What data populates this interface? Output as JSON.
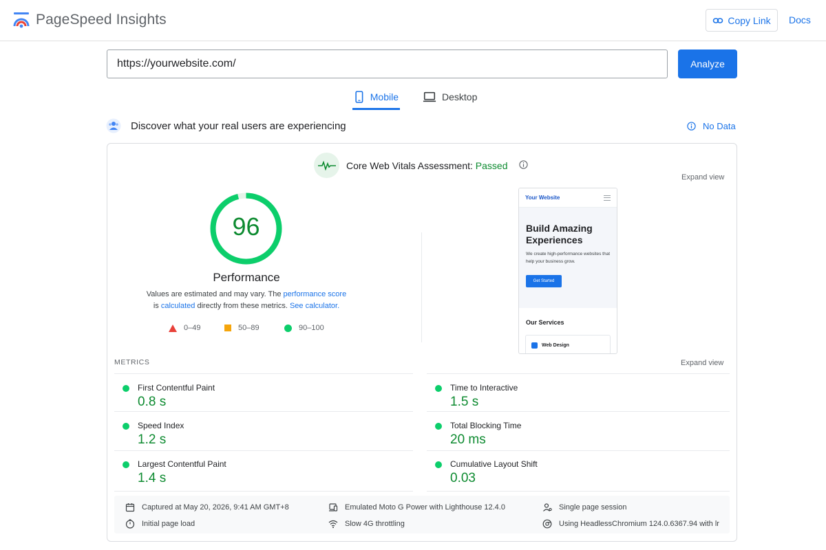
{
  "header": {
    "app_title": "PageSpeed Insights",
    "copy_link_label": "Copy Link",
    "docs_label": "Docs"
  },
  "url_bar": {
    "value": "https://yourwebsite.com/",
    "analyze_label": "Analyze"
  },
  "tabs": [
    {
      "label": "Mobile",
      "active": true
    },
    {
      "label": "Desktop",
      "active": false
    }
  ],
  "field_data": {
    "heading": "Discover what your real users are experiencing",
    "no_data_label": "No Data"
  },
  "assessment": {
    "label": "Core Web Vitals Assessment:",
    "status": "Passed",
    "expand_label": "Expand view"
  },
  "performance": {
    "score": "96",
    "score_fraction": 0.96,
    "title": "Performance",
    "desc_part1": "Values are estimated and may vary. The",
    "link_performance_score": "performance score",
    "desc_part2": "is",
    "link_calculated": "calculated",
    "desc_part3": "directly from these metrics.",
    "link_calculator": "See calculator."
  },
  "legend": [
    {
      "range": "0–49",
      "shape": "triangle",
      "color": "#e8413a"
    },
    {
      "range": "50–89",
      "shape": "square",
      "color": "#f5a50c"
    },
    {
      "range": "90–100",
      "shape": "circle",
      "color": "#0cce6b"
    }
  ],
  "preview": {
    "brand": "Your Website",
    "headline": "Build Amazing Experiences",
    "subtext": "We create high-performance websites that help your business grow.",
    "cta": "Get Started",
    "section_title": "Our Services",
    "service_item": "Web Design"
  },
  "metrics": {
    "title": "METRICS",
    "expand_label": "Expand view",
    "items": [
      {
        "label": "First Contentful Paint",
        "value": "0.8 s"
      },
      {
        "label": "Time to Interactive",
        "value": "1.5 s"
      },
      {
        "label": "Speed Index",
        "value": "1.2 s"
      },
      {
        "label": "Total Blocking Time",
        "value": "20 ms"
      },
      {
        "label": "Largest Contentful Paint",
        "value": "1.4 s"
      },
      {
        "label": "Cumulative Layout Shift",
        "value": "0.03"
      }
    ]
  },
  "run_info": {
    "captured": "Captured at May 20, 2026, 9:41 AM GMT+8",
    "device": "Emulated Moto G Power with Lighthouse 12.4.0",
    "session": "Single page session",
    "load": "Initial page load",
    "throttling": "Slow 4G throttling",
    "browser": "Using HeadlessChromium 124.0.6367.94 with lr"
  },
  "colors": {
    "accent": "#1a73e8",
    "pass_green": "#0c8a2f",
    "good_dot": "#0cce6b"
  }
}
